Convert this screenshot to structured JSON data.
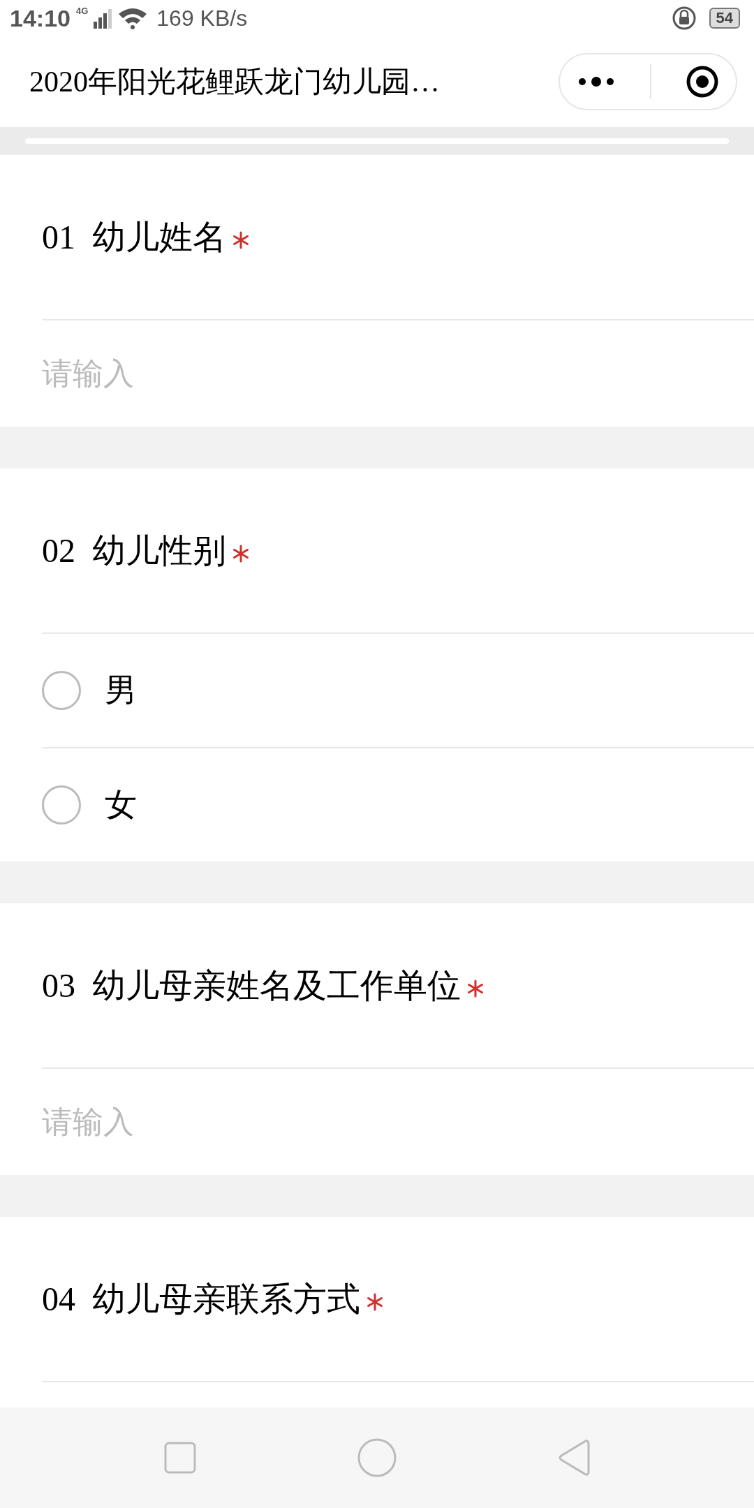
{
  "status_bar": {
    "time": "14:10",
    "network": "4G",
    "speed": "169 KB/s",
    "battery": "54"
  },
  "title": "2020年阳光花鲤跃龙门幼儿园…",
  "questions": [
    {
      "number": "01",
      "label": "幼儿姓名",
      "required": true,
      "kind": "text",
      "placeholder": "请输入"
    },
    {
      "number": "02",
      "label": "幼儿性别",
      "required": true,
      "kind": "radio",
      "options": [
        {
          "label": "男",
          "selected": false
        },
        {
          "label": "女",
          "selected": false
        }
      ]
    },
    {
      "number": "03",
      "label": "幼儿母亲姓名及工作单位",
      "required": true,
      "kind": "text",
      "placeholder": "请输入"
    },
    {
      "number": "04",
      "label": "幼儿母亲联系方式",
      "required": true,
      "kind": "text"
    }
  ]
}
